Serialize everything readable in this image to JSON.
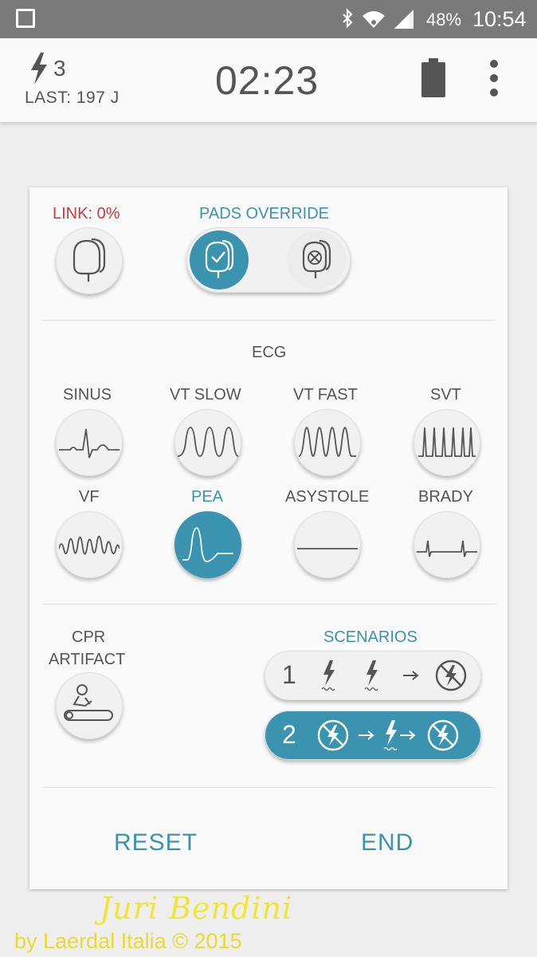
{
  "status_bar": {
    "battery_percent": "48%",
    "time": "10:54",
    "icons": [
      "square-icon",
      "bluetooth-icon",
      "wifi-icon",
      "signal-icon",
      "battery-icon"
    ]
  },
  "header": {
    "shock_count": "3",
    "last_shock": "LAST: 197 J",
    "timer": "02:23",
    "icons": [
      "lightning-icon",
      "device-battery-icon",
      "more-vert-icon"
    ]
  },
  "pads": {
    "link_label": "LINK: 0%",
    "override_label": "PADS OVERRIDE",
    "override_state": "connected"
  },
  "ecg": {
    "title": "ECG",
    "selected": "PEA",
    "rhythms": [
      {
        "label": "SINUS",
        "icon": "sinus-waveform-icon"
      },
      {
        "label": "VT SLOW",
        "icon": "vt-slow-waveform-icon"
      },
      {
        "label": "VT FAST",
        "icon": "vt-fast-waveform-icon"
      },
      {
        "label": "SVT",
        "icon": "svt-waveform-icon"
      },
      {
        "label": "VF",
        "icon": "vf-waveform-icon"
      },
      {
        "label": "PEA",
        "icon": "pea-waveform-icon"
      },
      {
        "label": "ASYSTOLE",
        "icon": "asystole-waveform-icon"
      },
      {
        "label": "BRADY",
        "icon": "brady-waveform-icon"
      }
    ]
  },
  "cpr": {
    "label_line1": "CPR",
    "label_line2": "ARTIFACT"
  },
  "scenarios": {
    "title": "SCENARIOS",
    "items": [
      {
        "number": "1",
        "active": false
      },
      {
        "number": "2",
        "active": true
      }
    ]
  },
  "actions": {
    "reset": "RESET",
    "end": "END"
  },
  "watermark": {
    "name": "Juri Bendini",
    "copyright": "by Laerdal Italia © 2015"
  },
  "colors": {
    "accent": "#3a94b0",
    "alert": "#d0373a",
    "status_bar": "#7a7a7a"
  }
}
